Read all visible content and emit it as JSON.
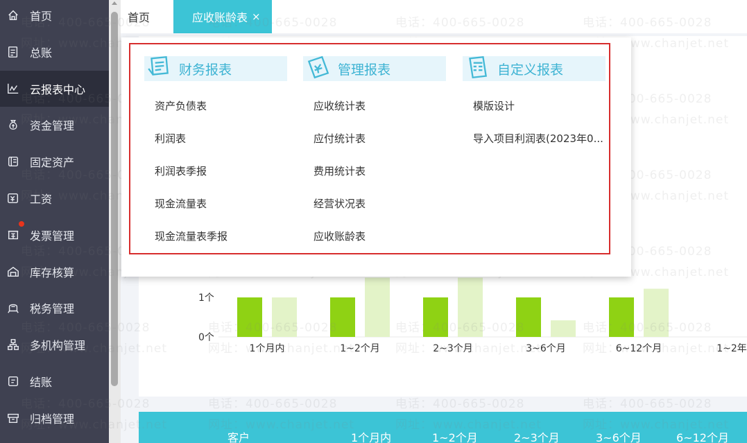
{
  "sidebar": {
    "items": [
      {
        "label": "首页",
        "icon": "home-icon"
      },
      {
        "label": "总账",
        "icon": "ledger-icon"
      },
      {
        "label": "云报表中心",
        "icon": "chart-line-icon"
      },
      {
        "label": "资金管理",
        "icon": "money-bag-icon"
      },
      {
        "label": "固定资产",
        "icon": "asset-icon"
      },
      {
        "label": "工资",
        "icon": "salary-icon"
      },
      {
        "label": "发票管理",
        "icon": "invoice-icon"
      },
      {
        "label": "库存核算",
        "icon": "warehouse-icon"
      },
      {
        "label": "税务管理",
        "icon": "tax-icon"
      },
      {
        "label": "多机构管理",
        "icon": "org-icon"
      },
      {
        "label": "结账",
        "icon": "checkout-icon"
      },
      {
        "label": "归档管理",
        "icon": "archive-icon"
      }
    ],
    "active_index": 2
  },
  "tabs": {
    "home": "首页",
    "active": "应收账龄表",
    "close": "×"
  },
  "watermark": {
    "phone": "电话：400-665-0028",
    "site": "网址：www.chanjet.net"
  },
  "popup": {
    "columns": [
      {
        "title": "财务报表",
        "icon": "finance-report-icon",
        "items": [
          "资产负债表",
          "利润表",
          "利润表季报",
          "现金流量表",
          "现金流量表季报"
        ]
      },
      {
        "title": "管理报表",
        "icon": "management-report-icon",
        "items": [
          "应收统计表",
          "应付统计表",
          "费用统计表",
          "经营状况表",
          "应收账龄表"
        ]
      },
      {
        "title": "自定义报表",
        "icon": "custom-report-icon",
        "items": [
          "模版设计",
          "导入项目利润表(2023年0..."
        ]
      }
    ]
  },
  "chart_data": {
    "type": "bar",
    "categories": [
      "1个月内",
      "1~2个月",
      "2~3个月",
      "3~6个月",
      "6~12个月",
      "1~2年"
    ],
    "y_tick_labels": [
      "0个",
      "1个"
    ],
    "series": [
      {
        "color": "#8fd214",
        "values": [
          1,
          1,
          1,
          1,
          1
        ]
      },
      {
        "color": "#e3f3c8",
        "values": [
          1,
          1.5,
          1.5,
          0.42,
          1.22
        ]
      }
    ],
    "ylim": [
      0,
      1.5
    ],
    "grid": false
  },
  "table": {
    "headers": [
      "客户",
      "1个月内",
      "1~2个月",
      "2~3个月",
      "3~6个月",
      "6~12个月"
    ]
  }
}
